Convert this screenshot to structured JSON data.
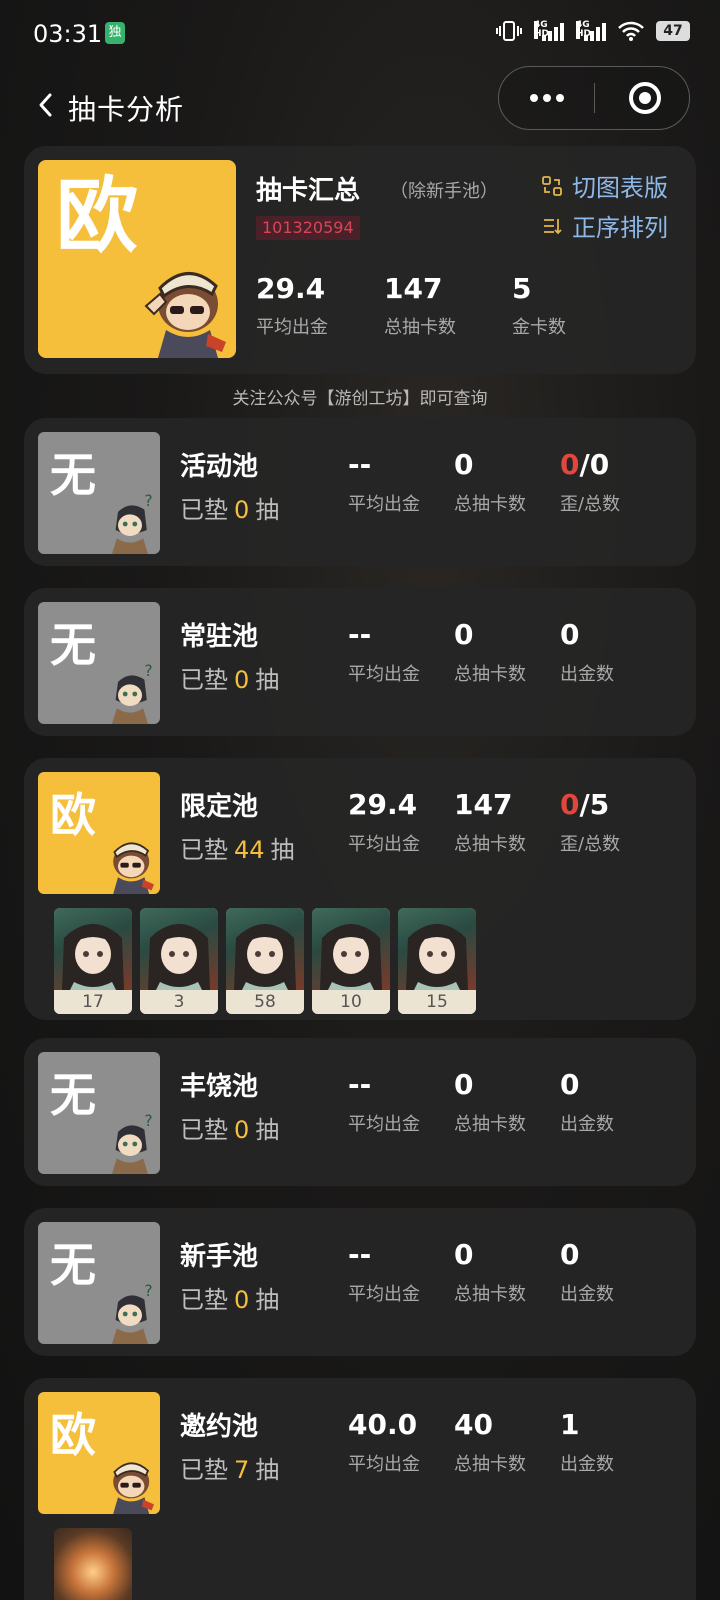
{
  "status": {
    "time": "03:31",
    "app_icon": "独",
    "net1": "4G HD",
    "net2": "4G HD",
    "battery": "47"
  },
  "nav": {
    "title": "抽卡分析"
  },
  "summary": {
    "avatar_char": "欧",
    "title": "抽卡汇总",
    "subtitle": "（除新手池）",
    "uid": "101320594",
    "switch_label": "切图表版",
    "sort_label": "正序排列",
    "stats": [
      {
        "value": "29.4",
        "label": "平均出金"
      },
      {
        "value": "147",
        "label": "总抽卡数"
      },
      {
        "value": "5",
        "label": "金卡数"
      }
    ]
  },
  "hint": "关注公众号【游创工坊】即可查询",
  "pity_prefix": "已垫",
  "pity_suffix": "抽",
  "pools": [
    {
      "name": "活动池",
      "avatar_char": "无",
      "pity": "0",
      "avg": "--",
      "avg_label": "平均出金",
      "total": "0",
      "total_label": "总抽卡数",
      "third_red": "0",
      "third_rest": "/0",
      "third_label": "歪/总数"
    },
    {
      "name": "常驻池",
      "avatar_char": "无",
      "pity": "0",
      "avg": "--",
      "avg_label": "平均出金",
      "total": "0",
      "total_label": "总抽卡数",
      "third_red": "",
      "third_rest": "0",
      "third_label": "出金数"
    },
    {
      "name": "限定池",
      "avatar_char": "欧",
      "pity": "44",
      "avg": "29.4",
      "avg_label": "平均出金",
      "total": "147",
      "total_label": "总抽卡数",
      "third_red": "0",
      "third_rest": "/5",
      "third_label": "歪/总数",
      "gold_counts": [
        "17",
        "3",
        "58",
        "10",
        "15"
      ]
    },
    {
      "name": "丰饶池",
      "avatar_char": "无",
      "pity": "0",
      "avg": "--",
      "avg_label": "平均出金",
      "total": "0",
      "total_label": "总抽卡数",
      "third_red": "",
      "third_rest": "0",
      "third_label": "出金数"
    },
    {
      "name": "新手池",
      "avatar_char": "无",
      "pity": "0",
      "avg": "--",
      "avg_label": "平均出金",
      "total": "0",
      "total_label": "总抽卡数",
      "third_red": "",
      "third_rest": "0",
      "third_label": "出金数"
    },
    {
      "name": "邀约池",
      "avatar_char": "欧",
      "pity": "7",
      "avg": "40.0",
      "avg_label": "平均出金",
      "total": "40",
      "total_label": "总抽卡数",
      "third_red": "",
      "third_rest": "1",
      "third_label": "出金数"
    }
  ],
  "colors": {
    "gold": "#f5bf3c",
    "red": "#e3463d",
    "link": "#8db8e8",
    "uid_bg": "#4a2128"
  }
}
